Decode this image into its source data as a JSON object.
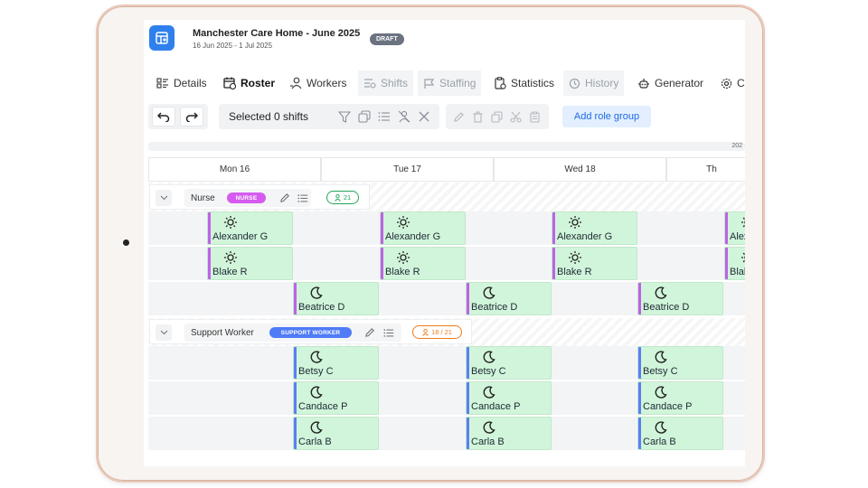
{
  "header": {
    "title": "Manchester Care Home - June 2025",
    "dates": "16 Jun 2025 - 1 Jul 2025",
    "status": "DRAFT"
  },
  "tabs": [
    {
      "label": "Details",
      "icon": "details-icon",
      "state": "normal"
    },
    {
      "label": "Roster",
      "icon": "roster-icon",
      "state": "active"
    },
    {
      "label": "Workers",
      "icon": "workers-icon",
      "state": "normal"
    },
    {
      "label": "Shifts",
      "icon": "shifts-icon",
      "state": "disabled"
    },
    {
      "label": "Staffing",
      "icon": "staffing-icon",
      "state": "disabled"
    },
    {
      "label": "Statistics",
      "icon": "statistics-icon",
      "state": "normal"
    },
    {
      "label": "History",
      "icon": "history-icon",
      "state": "disabled"
    },
    {
      "label": "Generator",
      "icon": "generator-icon",
      "state": "normal"
    },
    {
      "label": "Co",
      "icon": "settings-icon",
      "state": "normal"
    }
  ],
  "toolbar": {
    "selected": "Selected 0 shifts",
    "add_role_group": "Add role group"
  },
  "date_strip": "202",
  "days": [
    "Mon 16",
    "Tue 17",
    "Wed 18",
    "Th"
  ],
  "groups": [
    {
      "name": "Nurse",
      "role": "NURSE",
      "role_color": "#d65cf0",
      "count": "21",
      "count_color": "#22a55a",
      "rows": [
        {
          "type": "day",
          "worker": "Alexander G"
        },
        {
          "type": "day",
          "worker": "Blake R"
        },
        {
          "type": "night",
          "worker": "Beatrice D"
        }
      ]
    },
    {
      "name": "Support Worker",
      "role": "SUPPORT WORKER",
      "role_color": "#4f7bf7",
      "count": "18 / 21",
      "count_color": "#f07c1a",
      "rows": [
        {
          "type": "night",
          "worker": "Betsy C"
        },
        {
          "type": "night",
          "worker": "Candace P"
        },
        {
          "type": "night",
          "worker": "Carla B"
        }
      ]
    }
  ],
  "colors": {
    "accent": "#2f80ed",
    "shift_fill": "#d1f5da",
    "nurse_stripe": "#c061e8",
    "support_stripe": "#5b7ff2"
  },
  "icons": {
    "day_shift": "sun-icon",
    "night_shift": "moon-icon"
  }
}
